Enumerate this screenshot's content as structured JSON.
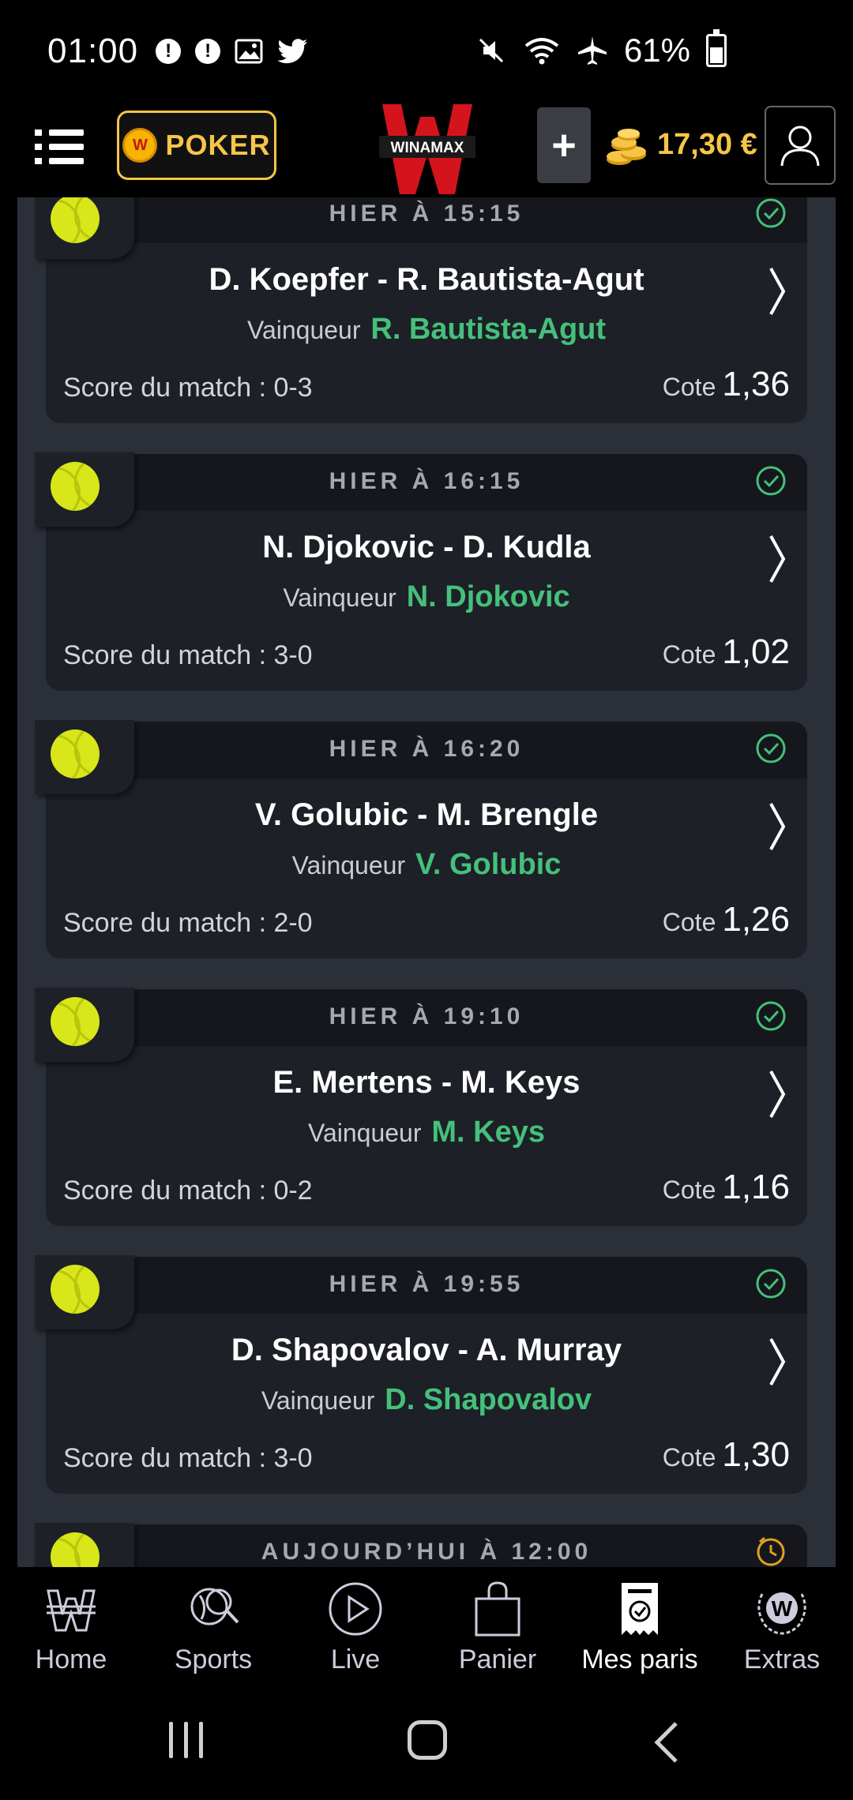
{
  "status_bar": {
    "time": "01:00",
    "battery": "61%"
  },
  "header": {
    "poker_label": "POKER",
    "logo_text": "WINAMAX",
    "plus_label": "+",
    "balance": "17,30 €"
  },
  "bets": [
    {
      "date": "HIER À 15:15",
      "match": "D. Koepfer - R. Bautista-Agut",
      "winner_label": "Vainqueur",
      "winner": "R. Bautista-Agut",
      "score": "Score du match : 0-3",
      "cote_label": "Cote",
      "odd": "1,36",
      "status": "won"
    },
    {
      "date": "HIER À 16:15",
      "match": "N. Djokovic - D. Kudla",
      "winner_label": "Vainqueur",
      "winner": "N. Djokovic",
      "score": "Score du match : 3-0",
      "cote_label": "Cote",
      "odd": "1,02",
      "status": "won"
    },
    {
      "date": "HIER À 16:20",
      "match": "V. Golubic - M. Brengle",
      "winner_label": "Vainqueur",
      "winner": "V. Golubic",
      "score": "Score du match : 2-0",
      "cote_label": "Cote",
      "odd": "1,26",
      "status": "won"
    },
    {
      "date": "HIER À 19:10",
      "match": "E. Mertens - M. Keys",
      "winner_label": "Vainqueur",
      "winner": "M. Keys",
      "score": "Score du match : 0-2",
      "cote_label": "Cote",
      "odd": "1,16",
      "status": "won"
    },
    {
      "date": "HIER À 19:55",
      "match": "D. Shapovalov - A. Murray",
      "winner_label": "Vainqueur",
      "winner": "D. Shapovalov",
      "score": "Score du match : 3-0",
      "cote_label": "Cote",
      "odd": "1,30",
      "status": "won"
    },
    {
      "date": "AUJOURD’HUI À 12:00",
      "status": "pending"
    }
  ],
  "bottom_nav": [
    {
      "label": "Home",
      "icon": "home-w-icon"
    },
    {
      "label": "Sports",
      "icon": "sports-search-icon"
    },
    {
      "label": "Live",
      "icon": "live-play-icon"
    },
    {
      "label": "Panier",
      "icon": "basket-bag-icon"
    },
    {
      "label": "Mes paris",
      "icon": "my-bets-ticket-icon",
      "active": true
    },
    {
      "label": "Extras",
      "icon": "extras-laurel-icon"
    }
  ],
  "colors": {
    "accent_gold": "#f6c548",
    "winner_green": "#45c07a",
    "pending_orange": "#e0a020",
    "card_bg": "#1d2027",
    "page_bg": "#2b2f38"
  }
}
